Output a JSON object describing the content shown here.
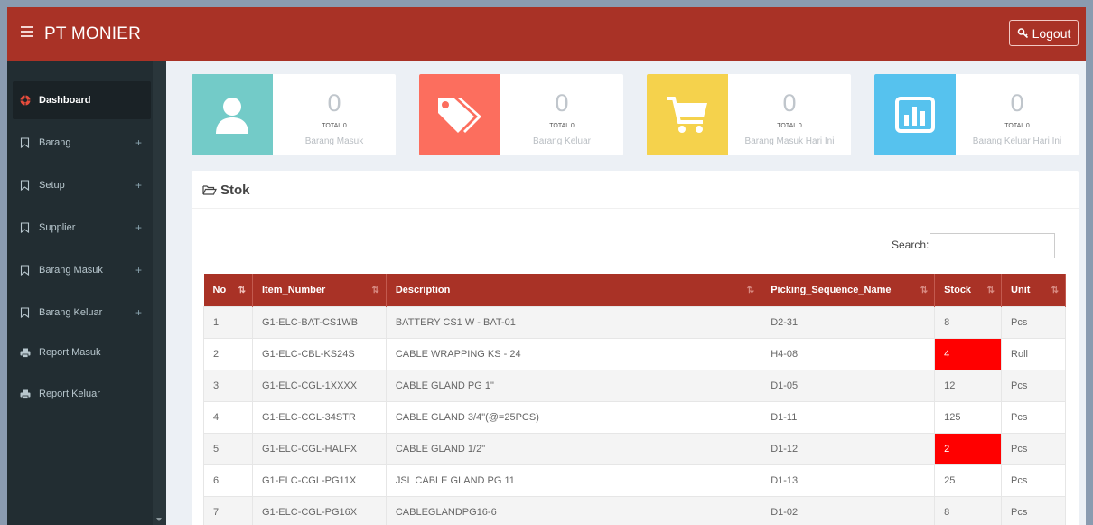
{
  "header": {
    "brand": "PT MONIER",
    "logout_label": "Logout"
  },
  "sidebar": {
    "items": [
      {
        "label": "Dashboard",
        "icon": "dashboard-icon",
        "active": true,
        "expandable": false
      },
      {
        "label": "Barang",
        "icon": "bookmark-icon",
        "expandable": true
      },
      {
        "label": "Setup",
        "icon": "bookmark-icon",
        "expandable": true
      },
      {
        "label": "Supplier",
        "icon": "bookmark-icon",
        "expandable": true
      },
      {
        "label": "Barang Masuk",
        "icon": "bookmark-icon",
        "expandable": true
      },
      {
        "label": "Barang Keluar",
        "icon": "bookmark-icon",
        "expandable": true
      },
      {
        "label": "Report Masuk",
        "icon": "print-icon",
        "expandable": false
      },
      {
        "label": "Report Keluar",
        "icon": "print-icon",
        "expandable": false
      }
    ],
    "plus": "+"
  },
  "cards": [
    {
      "value": "0",
      "total": "TOTAL 0",
      "label": "Barang Masuk",
      "color": "#73cbc8",
      "icon": "user-icon"
    },
    {
      "value": "0",
      "total": "TOTAL 0",
      "label": "Barang Keluar",
      "color": "#fc6e5e",
      "icon": "tags-icon"
    },
    {
      "value": "0",
      "total": "TOTAL 0",
      "label": "Barang Masuk Hari Ini",
      "color": "#f5d24c",
      "icon": "cart-icon"
    },
    {
      "value": "0",
      "total": "TOTAL 0",
      "label": "Barang Keluar Hari Ini",
      "color": "#56c2ee",
      "icon": "bar-chart-icon"
    }
  ],
  "stock": {
    "title": "Stok",
    "search_label": "Search:",
    "search_value": "",
    "columns": [
      "No",
      "Item_Number",
      "Description",
      "Picking_Sequence_Name",
      "Stock",
      "Unit"
    ],
    "rows": [
      {
        "no": "1",
        "item": "G1-ELC-BAT-CS1WB",
        "desc": "BATTERY CS1 W - BAT-01",
        "pick": "D2-31",
        "stock": "8",
        "unit": "Pcs",
        "low": false
      },
      {
        "no": "2",
        "item": "G1-ELC-CBL-KS24S",
        "desc": "CABLE WRAPPING KS - 24",
        "pick": "H4-08",
        "stock": "4",
        "unit": "Roll",
        "low": true
      },
      {
        "no": "3",
        "item": "G1-ELC-CGL-1XXXX",
        "desc": "CABLE GLAND PG 1\"",
        "pick": "D1-05",
        "stock": "12",
        "unit": "Pcs",
        "low": false
      },
      {
        "no": "4",
        "item": "G1-ELC-CGL-34STR",
        "desc": "CABLE GLAND 3/4\"(@=25PCS)",
        "pick": "D1-11",
        "stock": "125",
        "unit": "Pcs",
        "low": false
      },
      {
        "no": "5",
        "item": "G1-ELC-CGL-HALFX",
        "desc": "CABLE GLAND 1/2\"",
        "pick": "D1-12",
        "stock": "2",
        "unit": "Pcs",
        "low": true
      },
      {
        "no": "6",
        "item": "G1-ELC-CGL-PG11X",
        "desc": "JSL CABLE GLAND PG 11",
        "pick": "D1-13",
        "stock": "25",
        "unit": "Pcs",
        "low": false
      },
      {
        "no": "7",
        "item": "G1-ELC-CGL-PG16X",
        "desc": "CABLEGLANDPG16-6",
        "pick": "D1-02",
        "stock": "8",
        "unit": "Pcs",
        "low": false
      }
    ]
  },
  "colors": {
    "header": "#a93226",
    "sidebar": "#222d32",
    "low_stock": "#ff0000"
  }
}
